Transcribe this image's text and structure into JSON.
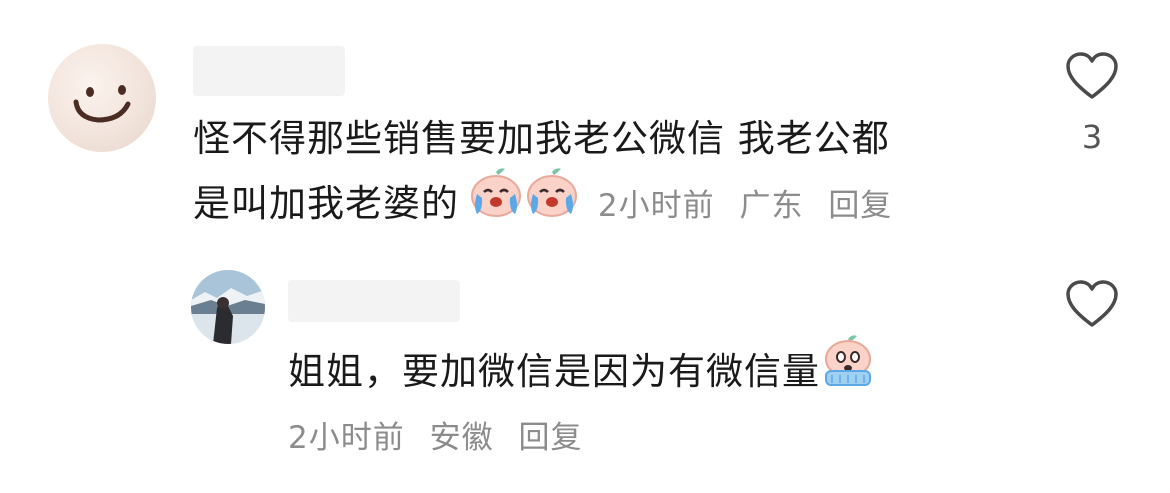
{
  "comments": [
    {
      "text_line1": "怪不得那些销售要加我老公微信 我老公都",
      "text_line2": "是叫加我老婆的",
      "emojis": [
        "crying-peach-emoji",
        "crying-peach-emoji"
      ],
      "time": "2小时前",
      "location": "广东",
      "reply_label": "回复",
      "likes": "3"
    },
    {
      "text": "姐姐，要加微信是因为有微信量",
      "emojis": [
        "scared-peach-emoji"
      ],
      "time": "2小时前",
      "location": "安徽",
      "reply_label": "回复"
    }
  ],
  "icons": {
    "like": "heart-outline-icon",
    "avatar1": "smiley-face-avatar",
    "avatar2": "mountain-photo-avatar"
  },
  "colors": {
    "text": "#1a1a1a",
    "meta": "#8c8c8c",
    "redacted": "#f3f3f3"
  }
}
